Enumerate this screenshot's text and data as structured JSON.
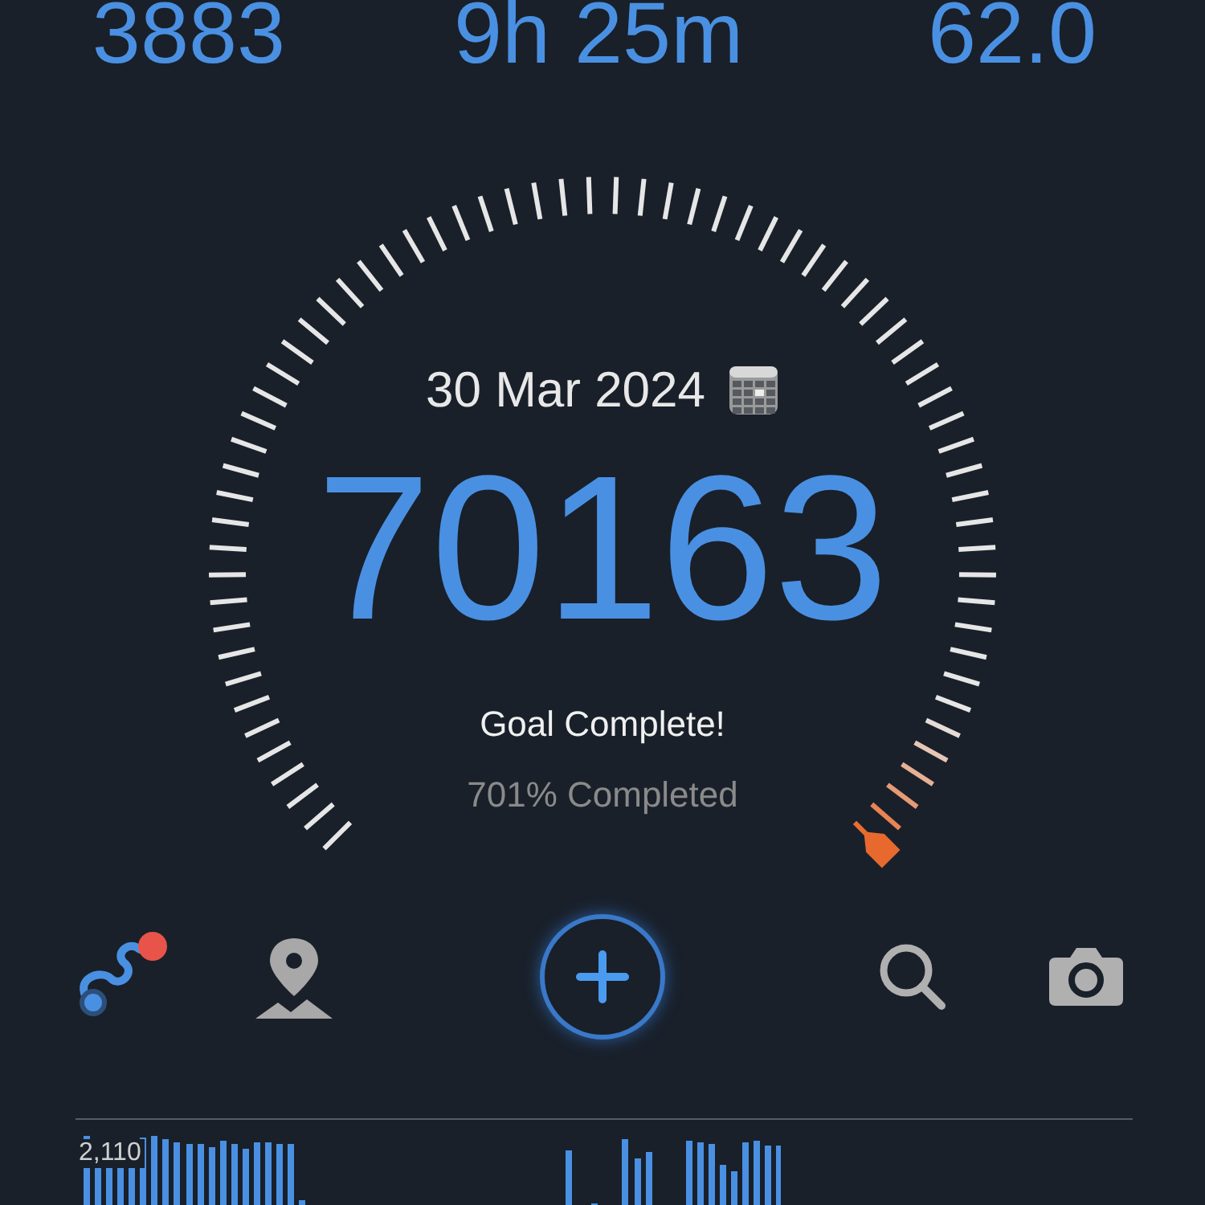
{
  "stats": [
    {
      "value": "3883"
    },
    {
      "value": "9h 25m"
    },
    {
      "value": "62.0"
    }
  ],
  "gauge": {
    "date": "30 Mar 2024",
    "steps": "70163",
    "status": "Goal Complete!",
    "progress_text": "701% Completed"
  },
  "activity": {
    "peak_label": "2,110"
  }
}
